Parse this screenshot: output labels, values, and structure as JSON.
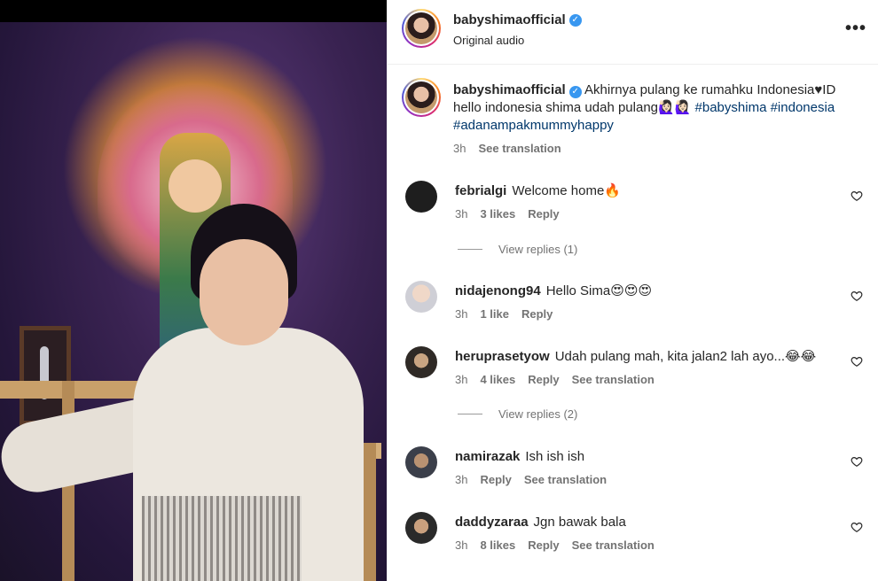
{
  "post": {
    "username": "babyshimaofficial",
    "audio": "Original audio",
    "more_icon": "more-horizontal-icon"
  },
  "caption": {
    "username": "babyshimaofficial",
    "text": "Akhirnya pulang ke rumahku Indonesia♥ID hello indonesia shima udah pulang🙋🏻‍♀️🙋🏻‍♀️",
    "hashtags": [
      "#babyshima",
      "#indonesia",
      "#adanampakmummyhappy"
    ],
    "time": "3h",
    "see_translation": "See translation"
  },
  "comments": [
    {
      "username": "febrialgi",
      "text": "Welcome home🔥",
      "time": "3h",
      "likes": "3 likes",
      "reply": "Reply",
      "translation": "",
      "view_replies": "View replies (1)"
    },
    {
      "username": "nidajenong94",
      "text": "Hello Sima😍😍😍",
      "time": "3h",
      "likes": "1 like",
      "reply": "Reply",
      "translation": "",
      "view_replies": ""
    },
    {
      "username": "heruprasetyow",
      "text": "Udah pulang mah, kita jalan2 lah ayo...😂😂",
      "time": "3h",
      "likes": "4 likes",
      "reply": "Reply",
      "translation": "See translation",
      "view_replies": "View replies (2)"
    },
    {
      "username": "namirazak",
      "text": "Ish ish ish",
      "time": "3h",
      "likes": "",
      "reply": "Reply",
      "translation": "See translation",
      "view_replies": ""
    },
    {
      "username": "daddyzaraa",
      "text": "Jgn bawak bala",
      "time": "3h",
      "likes": "8 likes",
      "reply": "Reply",
      "translation": "See translation",
      "view_replies": ""
    }
  ],
  "colors": {
    "link": "#00376b",
    "meta": "#737373",
    "verified": "#3897f0"
  }
}
